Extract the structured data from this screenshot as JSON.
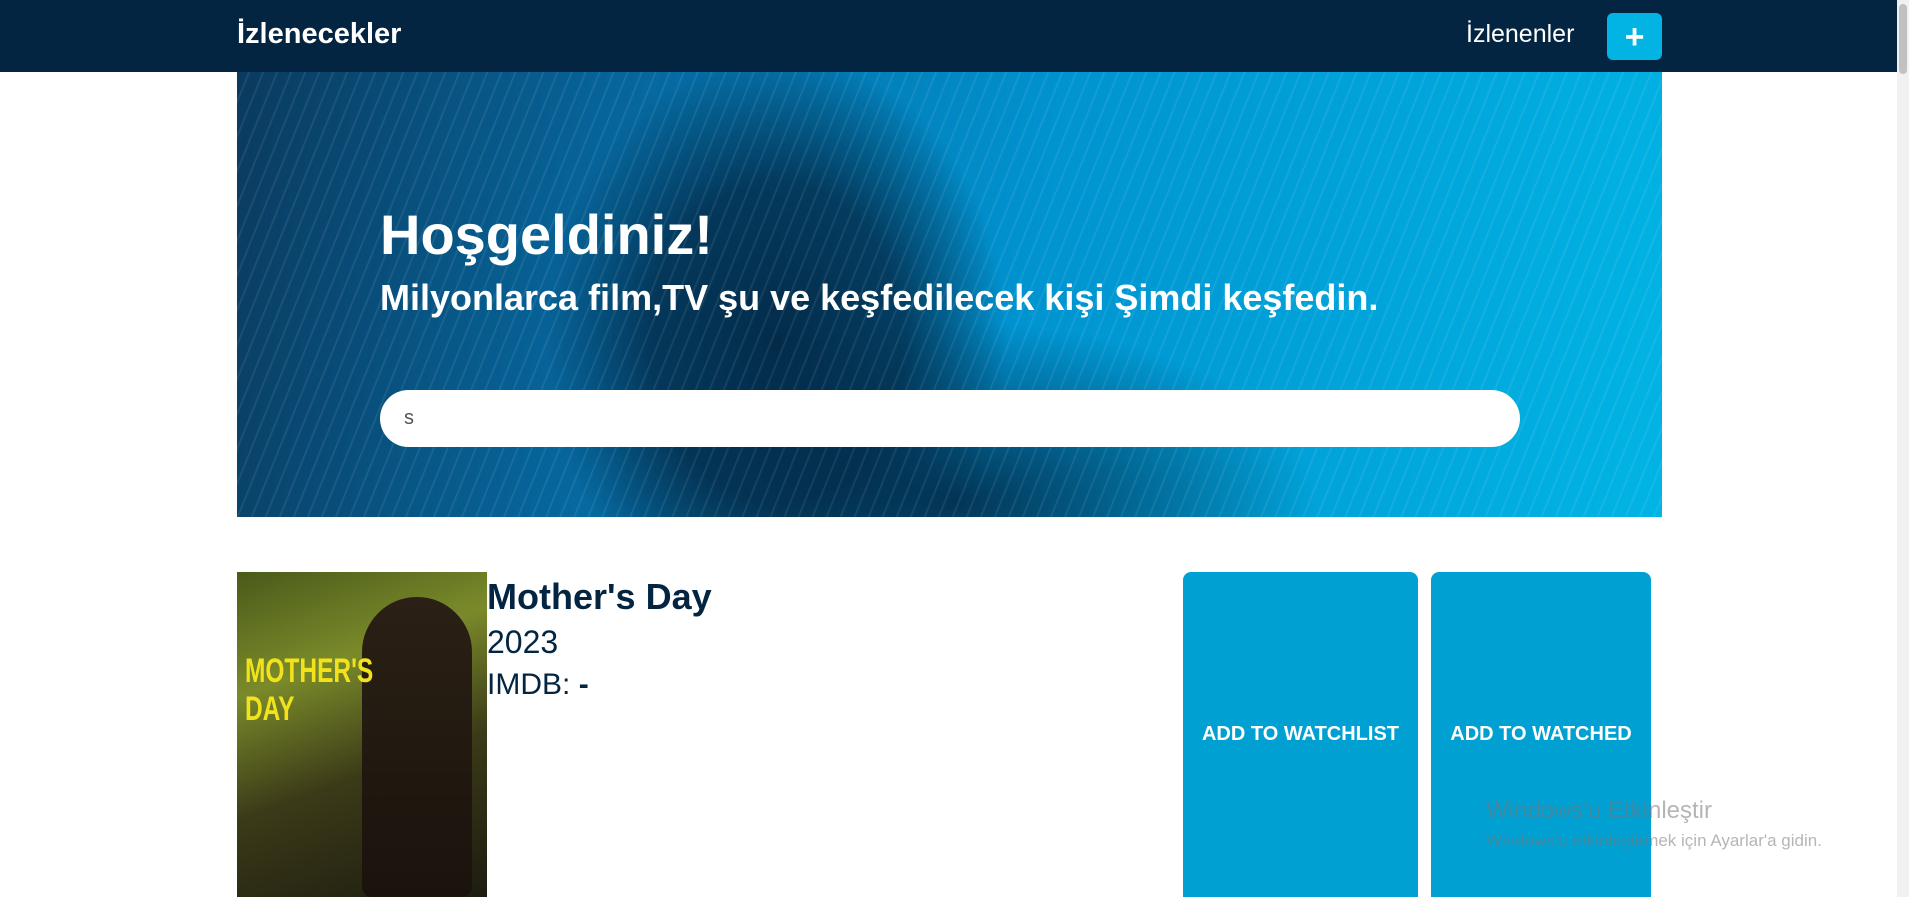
{
  "navbar": {
    "brand": "İzlenecekler",
    "watched_link": "İzlenenler",
    "add_label": "+"
  },
  "hero": {
    "title": "Hoşgeldiniz!",
    "subtitle": "Milyonlarca film,TV şu ve keşfedilecek kişi Şimdi keşfedin.",
    "search_value": "s"
  },
  "result": {
    "poster_text": "MOTHER'S DAY",
    "title": "Mother's Day",
    "year": "2023",
    "imdb_label": "IMDB:",
    "imdb_value": "-",
    "watchlist_button": "ADD TO WATCHLIST",
    "watched_button": "ADD TO WATCHED"
  },
  "windows_activation": {
    "title": "Windows'u Etkinleştir",
    "subtitle": "Windows'u etkinleştirmek için Ayarlar'a gidin."
  },
  "colors": {
    "navbar_bg": "#032541",
    "accent": "#01b4e4",
    "button": "#01a0d3",
    "text_dark": "#032541"
  }
}
